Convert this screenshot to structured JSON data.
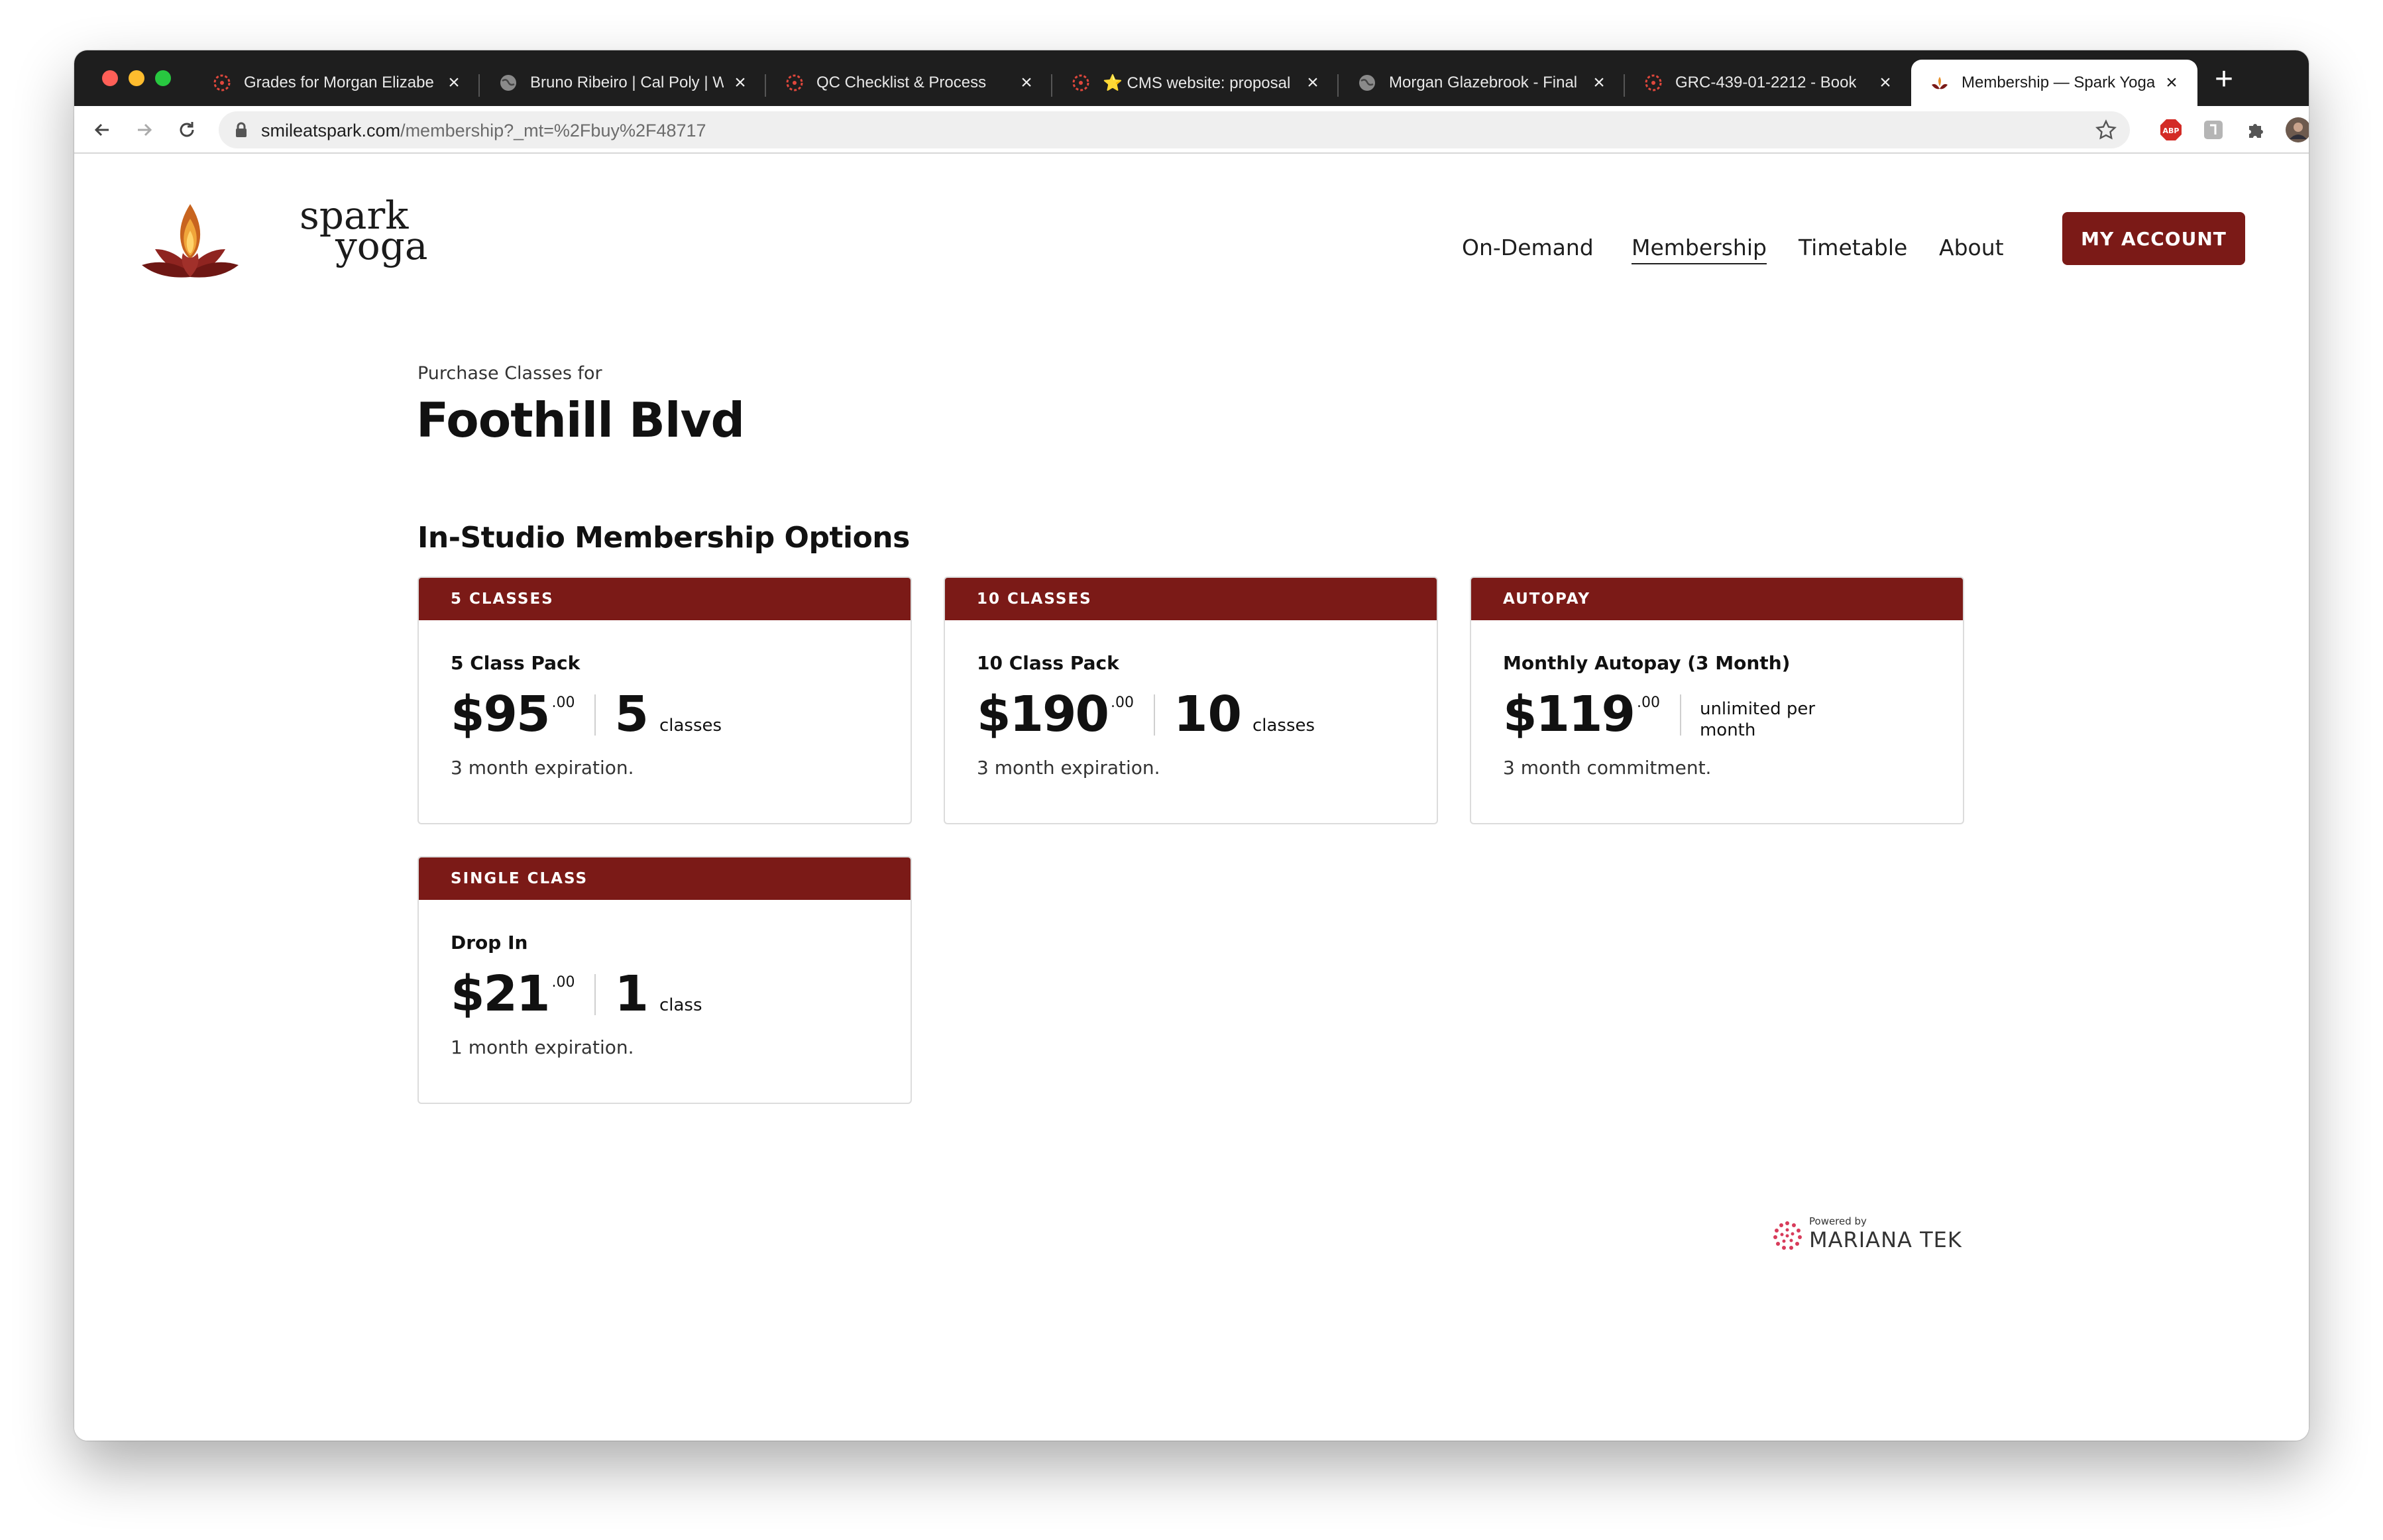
{
  "browser": {
    "tabs": [
      {
        "title": "Grades for Morgan Elizabe",
        "icon": "canvas-icon"
      },
      {
        "title": "Bruno Ribeiro | Cal Poly | W",
        "icon": "globe-icon"
      },
      {
        "title": "QC Checklist & Process",
        "icon": "canvas-icon"
      },
      {
        "title": "⭐ CMS website: proposal",
        "icon": "canvas-icon"
      },
      {
        "title": "Morgan Glazebrook - Final",
        "icon": "globe-icon"
      },
      {
        "title": "GRC-439-01-2212 - Book",
        "icon": "canvas-icon"
      },
      {
        "title": "Membership — Spark Yoga",
        "icon": "spark-yoga-icon",
        "active": true
      }
    ],
    "new_tab_label": "+",
    "url_host": "smileatspark.com",
    "url_path": "/membership?_mt=%2Fbuy%2F48717"
  },
  "site": {
    "logo_line1": "spark",
    "logo_line2": "yoga",
    "nav": [
      {
        "label": "On-Demand"
      },
      {
        "label": "Membership",
        "active": true
      },
      {
        "label": "Timetable"
      },
      {
        "label": "About"
      }
    ],
    "account_button": "MY ACCOUNT",
    "accent_color": "#7b1a17"
  },
  "purchase": {
    "eyebrow": "Purchase Classes for",
    "location": "Foothill Blvd",
    "section_title": "In-Studio Membership Options"
  },
  "cards": [
    {
      "category": "5 CLASSES",
      "name": "5 Class Pack",
      "price": "$95",
      "cents": ".00",
      "qty": "5",
      "qty_label": "classes",
      "note": "3 month expiration."
    },
    {
      "category": "10 CLASSES",
      "name": "10 Class Pack",
      "price": "$190",
      "cents": ".00",
      "qty": "10",
      "qty_label": "classes",
      "note": "3 month expiration."
    },
    {
      "category": "AUTOPAY",
      "name": "Monthly Autopay (3 Month)",
      "price": "$119",
      "cents": ".00",
      "qty_label": "unlimited per month",
      "note": "3 month commitment."
    },
    {
      "category": "SINGLE CLASS",
      "name": "Drop In",
      "price": "$21",
      "cents": ".00",
      "qty": "1",
      "qty_label": "class",
      "note": "1 month expiration."
    }
  ],
  "footer": {
    "powered_by": "Powered by",
    "brand": "MARIANA TEK"
  }
}
